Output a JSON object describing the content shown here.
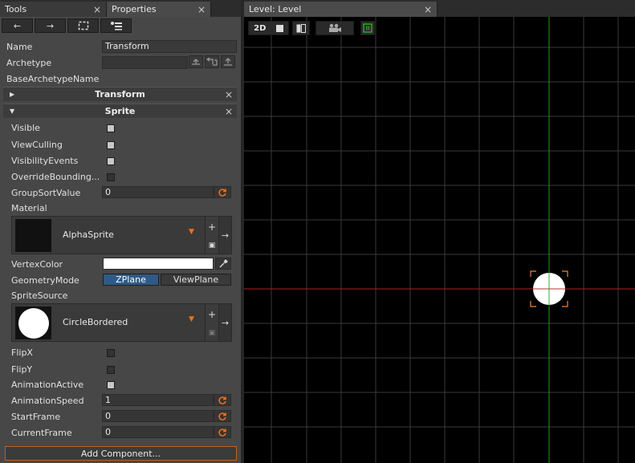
{
  "tabs": {
    "tools": {
      "label": "Tools",
      "close": "×"
    },
    "properties": {
      "label": "Properties",
      "close": "×"
    },
    "level": {
      "label": "Level: Level",
      "close": "×"
    }
  },
  "toolbar": {
    "back": "←",
    "forward": "→",
    "select": "⛶",
    "hierarchy": "≣"
  },
  "object": {
    "name_label": "Name",
    "name_value": "Transform",
    "archetype_label": "Archetype",
    "archetype_value": "",
    "base_archetype_label": "BaseArchetypeName"
  },
  "transform_section": {
    "title": "Transform",
    "arrow": "▶",
    "close": "×"
  },
  "sprite_section": {
    "title": "Sprite",
    "arrow": "▼",
    "close": "×",
    "visible_label": "Visible",
    "visible": true,
    "view_culling_label": "ViewCulling",
    "view_culling": true,
    "visibility_events_label": "VisibilityEvents",
    "visibility_events": true,
    "override_bounding_label": "OverrideBounding...",
    "override_bounding": false,
    "group_sort_label": "GroupSortValue",
    "group_sort_value": "0",
    "material_label": "Material",
    "material_value": "AlphaSprite",
    "vertex_color_label": "VertexColor",
    "vertex_color": "#ffffff",
    "geometry_mode_label": "GeometryMode",
    "geometry_mode_options": [
      "ZPlane",
      "ViewPlane"
    ],
    "geometry_mode_selected": "ZPlane",
    "sprite_source_label": "SpriteSource",
    "sprite_source_value": "CircleBordered",
    "flip_x_label": "FlipX",
    "flip_x": false,
    "flip_y_label": "FlipY",
    "flip_y": false,
    "animation_active_label": "AnimationActive",
    "animation_active": true,
    "animation_speed_label": "AnimationSpeed",
    "animation_speed": "1",
    "start_frame_label": "StartFrame",
    "start_frame": "0",
    "current_frame_label": "CurrentFrame",
    "current_frame": "0"
  },
  "picker_buttons": {
    "add": "+",
    "copy": "⧉",
    "go": "→"
  },
  "add_component_label": "Add Component...",
  "viewport_toolbar": {
    "mode_2d": "2D"
  },
  "colors": {
    "accent_orange": "#f07020",
    "selected_toggle": "#2f5a86",
    "grid_line": "#3a3a3a",
    "x_axis": "#c02020",
    "y_axis": "#20b020",
    "selection": "#f08040"
  },
  "icons": {
    "reset": "refresh-icon",
    "eyedropper": "eyedropper-icon",
    "camera": "camera-icon",
    "snap": "snap-grid-icon"
  }
}
